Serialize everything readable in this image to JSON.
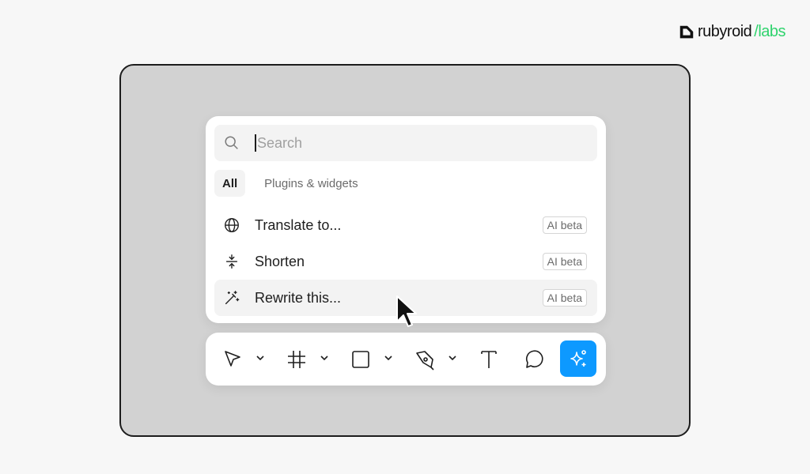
{
  "logo": {
    "part1": "rubyroid",
    "part2": "labs"
  },
  "search": {
    "placeholder": "Search",
    "value": ""
  },
  "tabs": [
    {
      "label": "All",
      "active": true
    },
    {
      "label": "Plugins & widgets",
      "active": false
    }
  ],
  "items": [
    {
      "icon": "globe-icon",
      "label": "Translate to...",
      "badge": "AI beta"
    },
    {
      "icon": "shorten-icon",
      "label": "Shorten",
      "badge": "AI beta"
    },
    {
      "icon": "magic-wand-icon",
      "label": "Rewrite this...",
      "badge": "AI beta",
      "hovered": true
    }
  ],
  "toolbar": {
    "tools": [
      "move-tool",
      "frame-tool",
      "shape-tool",
      "pen-tool",
      "text-tool",
      "comment-tool",
      "ai-tool"
    ],
    "active": "ai-tool"
  },
  "colors": {
    "accent": "#0d99ff",
    "brand_green": "#2fd36d",
    "canvas": "#d2d2d2"
  }
}
